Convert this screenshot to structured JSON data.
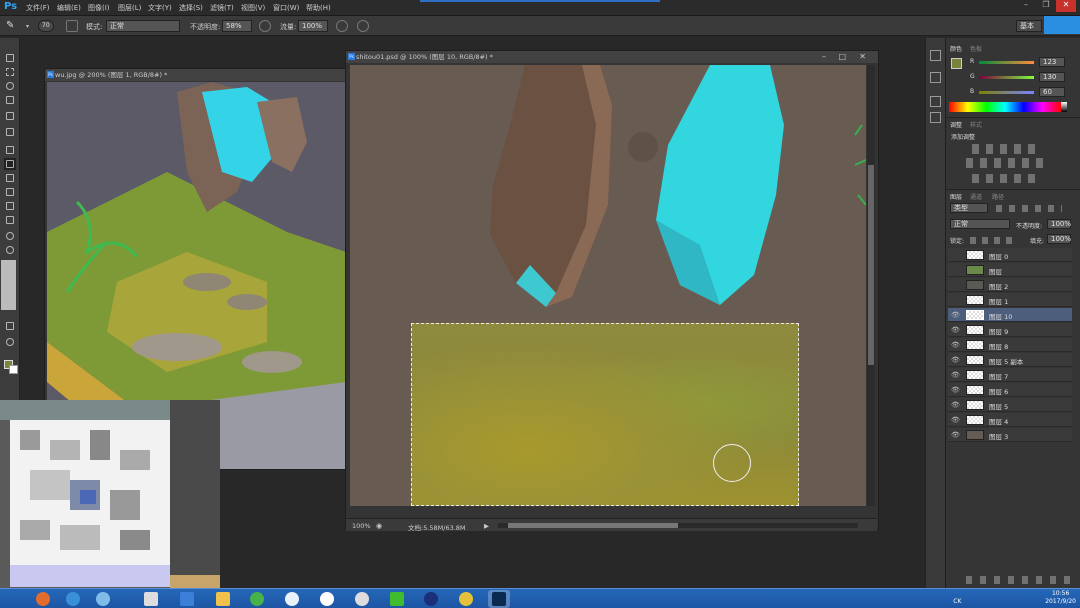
{
  "menubar": {
    "logo": "Ps",
    "items": [
      "文件(F)",
      "编辑(E)",
      "图像(I)",
      "图层(L)",
      "文字(Y)",
      "选择(S)",
      "滤镜(T)",
      "视图(V)",
      "窗口(W)",
      "帮助(H)"
    ]
  },
  "options": {
    "brush_size": "70",
    "mode_label": "模式:",
    "mode_value": "正常",
    "opacity_label": "不透明度:",
    "opacity_value": "58%",
    "flow_label": "流量:",
    "flow_value": "100%",
    "workspace_label": "基本"
  },
  "documents": {
    "doc1_title": "wu.jpg @ 200% (图层 1, RGB/8#) *",
    "doc2_title": "shitou01.psd @ 100% (图层 10, RGB/8#) *",
    "doc2_zoom": "100%",
    "doc2_docsize": "文档:5.58M/63.8M"
  },
  "panels": {
    "color_tab": "颜色",
    "swatches_tab": "色板",
    "r_label": "R",
    "g_label": "G",
    "b_label": "B",
    "r_value": "123",
    "g_value": "130",
    "b_value": "60",
    "adjust_tab": "调整",
    "styles_tab": "样式",
    "adjust_title": "添加调整",
    "layers_tab": "图层",
    "channels_tab": "通道",
    "paths_tab": "路径",
    "kind_label": "类型",
    "blend_mode": "正常",
    "layer_opacity_label": "不透明度:",
    "layer_opacity_value": "100%",
    "lock_label": "锁定:",
    "fill_label": "填充:",
    "fill_value": "100%",
    "layers": [
      {
        "name": "图层 0"
      },
      {
        "name": "图层"
      },
      {
        "name": "图层 2"
      },
      {
        "name": "图层 1"
      },
      {
        "name": "图层 10"
      },
      {
        "name": "图层 9"
      },
      {
        "name": "图层 8"
      },
      {
        "name": "图层 5 副本"
      },
      {
        "name": "图层 7"
      },
      {
        "name": "图层 6"
      },
      {
        "name": "图层 5"
      },
      {
        "name": "图层 4"
      },
      {
        "name": "图层 3"
      }
    ]
  },
  "taskbar": {
    "time": "10:56",
    "date": "2017/9/20",
    "tray_text": "CK"
  },
  "colors": {
    "foreground": "#7b823c",
    "canvas_bg": "#675b52",
    "crystal": "#31d6de"
  }
}
